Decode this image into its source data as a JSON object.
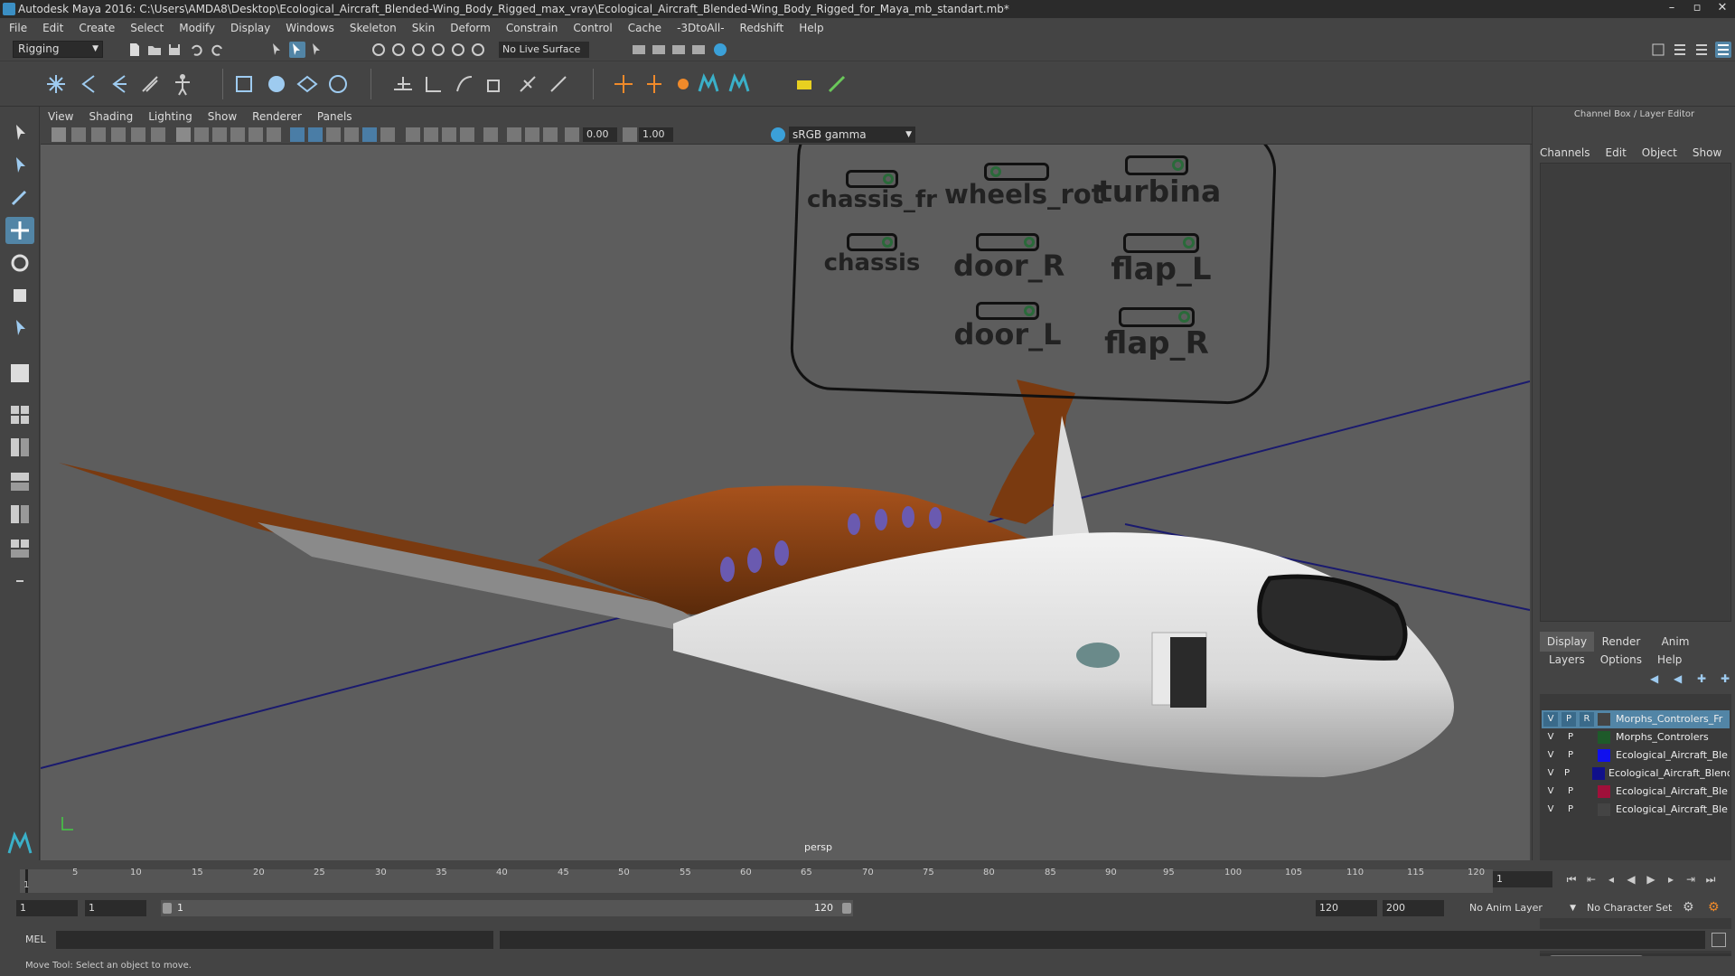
{
  "window": {
    "title": "Autodesk Maya 2016: C:\\Users\\AMDA8\\Desktop\\Ecological_Aircraft_Blended-Wing_Body_Rigged_max_vray\\Ecological_Aircraft_Blended-Wing_Body_Rigged_for_Maya_mb_standart.mb*"
  },
  "menubar": [
    "File",
    "Edit",
    "Create",
    "Select",
    "Modify",
    "Display",
    "Windows",
    "Skeleton",
    "Skin",
    "Deform",
    "Constrain",
    "Control",
    "Cache",
    "-3DtoAll-",
    "Redshift",
    "Help"
  ],
  "toolbar": {
    "mode": "Rigging",
    "live_surface": "No Live Surface"
  },
  "viewport": {
    "menu": [
      "View",
      "Shading",
      "Lighting",
      "Show",
      "Renderer",
      "Panels"
    ],
    "exposure": "0.00",
    "gamma": "1.00",
    "color_space": "sRGB gamma",
    "camera": "persp",
    "controls": [
      "chassis_fr",
      "wheels_rot",
      "turbina",
      "chassis",
      "door_R",
      "flap_L",
      "door_L",
      "flap_R"
    ]
  },
  "channel_box": {
    "title": "Channel Box / Layer Editor",
    "menu": [
      "Channels",
      "Edit",
      "Object",
      "Show"
    ]
  },
  "layer_editor": {
    "tabs": [
      "Display",
      "Render",
      "Anim"
    ],
    "menu": [
      "Layers",
      "Options",
      "Help"
    ],
    "layers": [
      {
        "v": "V",
        "p": "P",
        "r": "R",
        "color": "#444444",
        "name": "Morphs_Controlers_Fr",
        "selected": true
      },
      {
        "v": "V",
        "p": "P",
        "r": "",
        "color": "#1e5a2a",
        "name": "Morphs_Controlers",
        "selected": false
      },
      {
        "v": "V",
        "p": "P",
        "r": "",
        "color": "#1010ee",
        "name": "Ecological_Aircraft_Ble",
        "selected": false
      },
      {
        "v": "V",
        "p": "P",
        "r": "",
        "color": "#10108a",
        "name": "Ecological_Aircraft_Blend",
        "selected": false
      },
      {
        "v": "V",
        "p": "P",
        "r": "",
        "color": "#a0103a",
        "name": "Ecological_Aircraft_Ble",
        "selected": false
      },
      {
        "v": "V",
        "p": "P",
        "r": "",
        "color": "#444444",
        "name": "Ecological_Aircraft_Ble",
        "selected": false
      }
    ]
  },
  "timeline": {
    "ticks": [
      "5",
      "10",
      "15",
      "20",
      "25",
      "30",
      "35",
      "40",
      "45",
      "50",
      "55",
      "60",
      "65",
      "70",
      "75",
      "80",
      "85",
      "90",
      "95",
      "100",
      "105",
      "110",
      "115",
      "120"
    ],
    "start_label": "1",
    "current_frame": "1"
  },
  "range": {
    "start": "1",
    "anim_start": "1",
    "slider_left": "1",
    "slider_right": "120",
    "end": "120",
    "anim_end": "200",
    "anim_layer": "No Anim Layer",
    "char_set": "No Character Set"
  },
  "command": {
    "label": "MEL"
  },
  "help_line": "Move Tool: Select an object to move."
}
